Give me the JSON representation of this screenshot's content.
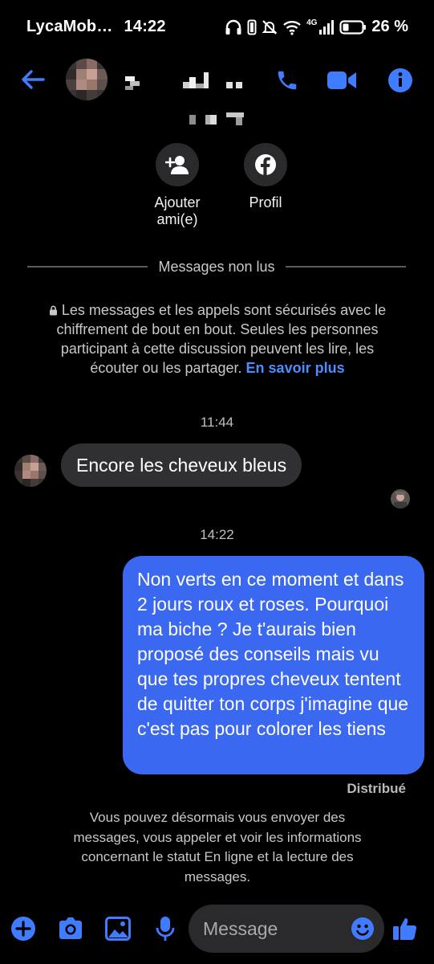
{
  "status_bar": {
    "carrier": "LycaMob…",
    "time": "14:22",
    "network_label": "4G",
    "battery": "26 %"
  },
  "header": {
    "back_icon": "arrow-left-icon",
    "call_icon": "phone-icon",
    "video_icon": "video-camera-icon",
    "info_icon": "info-icon",
    "accent": "#3f7cff"
  },
  "profile_actions": [
    {
      "label_line1": "Ajouter",
      "label_line2": "ami(e)",
      "icon": "add-friend-icon"
    },
    {
      "label_line1": "Profil",
      "label_line2": "",
      "icon": "facebook-icon"
    }
  ],
  "divider_text": "Messages non lus",
  "encryption_notice": {
    "text": "Les messages et les appels sont sécurisés avec le chiffrement de bout en bout. Seules les personnes participant à cette discussion peuvent les lire, les écouter ou les partager.",
    "link": "En savoir plus"
  },
  "messages": [
    {
      "time": "11:44",
      "direction": "incoming",
      "text": "Encore les cheveux bleus"
    },
    {
      "time": "14:22",
      "direction": "outgoing",
      "text": "Non verts en ce moment et dans 2 jours roux et roses. Pourquoi ma biche ? Je t'aurais bien proposé des conseils mais vu que tes propres cheveux tentent de quitter ton corps j'imagine que c'est pas pour colorer les tiens",
      "status": "Distribué"
    }
  ],
  "bottom_notice": "Vous pouvez désormais vous envoyer des messages, vous appeler et voir les informations concernant le statut En ligne et la lecture des messages.",
  "composer": {
    "placeholder": "Message",
    "icons": [
      "plus-icon",
      "camera-icon",
      "image-icon",
      "microphone-icon",
      "emoji-icon",
      "thumbs-up-icon"
    ]
  },
  "colors": {
    "accent": "#3f7cff",
    "outgoing_bubble": "#3b68f0",
    "incoming_bubble": "#303033",
    "background": "#000000"
  }
}
